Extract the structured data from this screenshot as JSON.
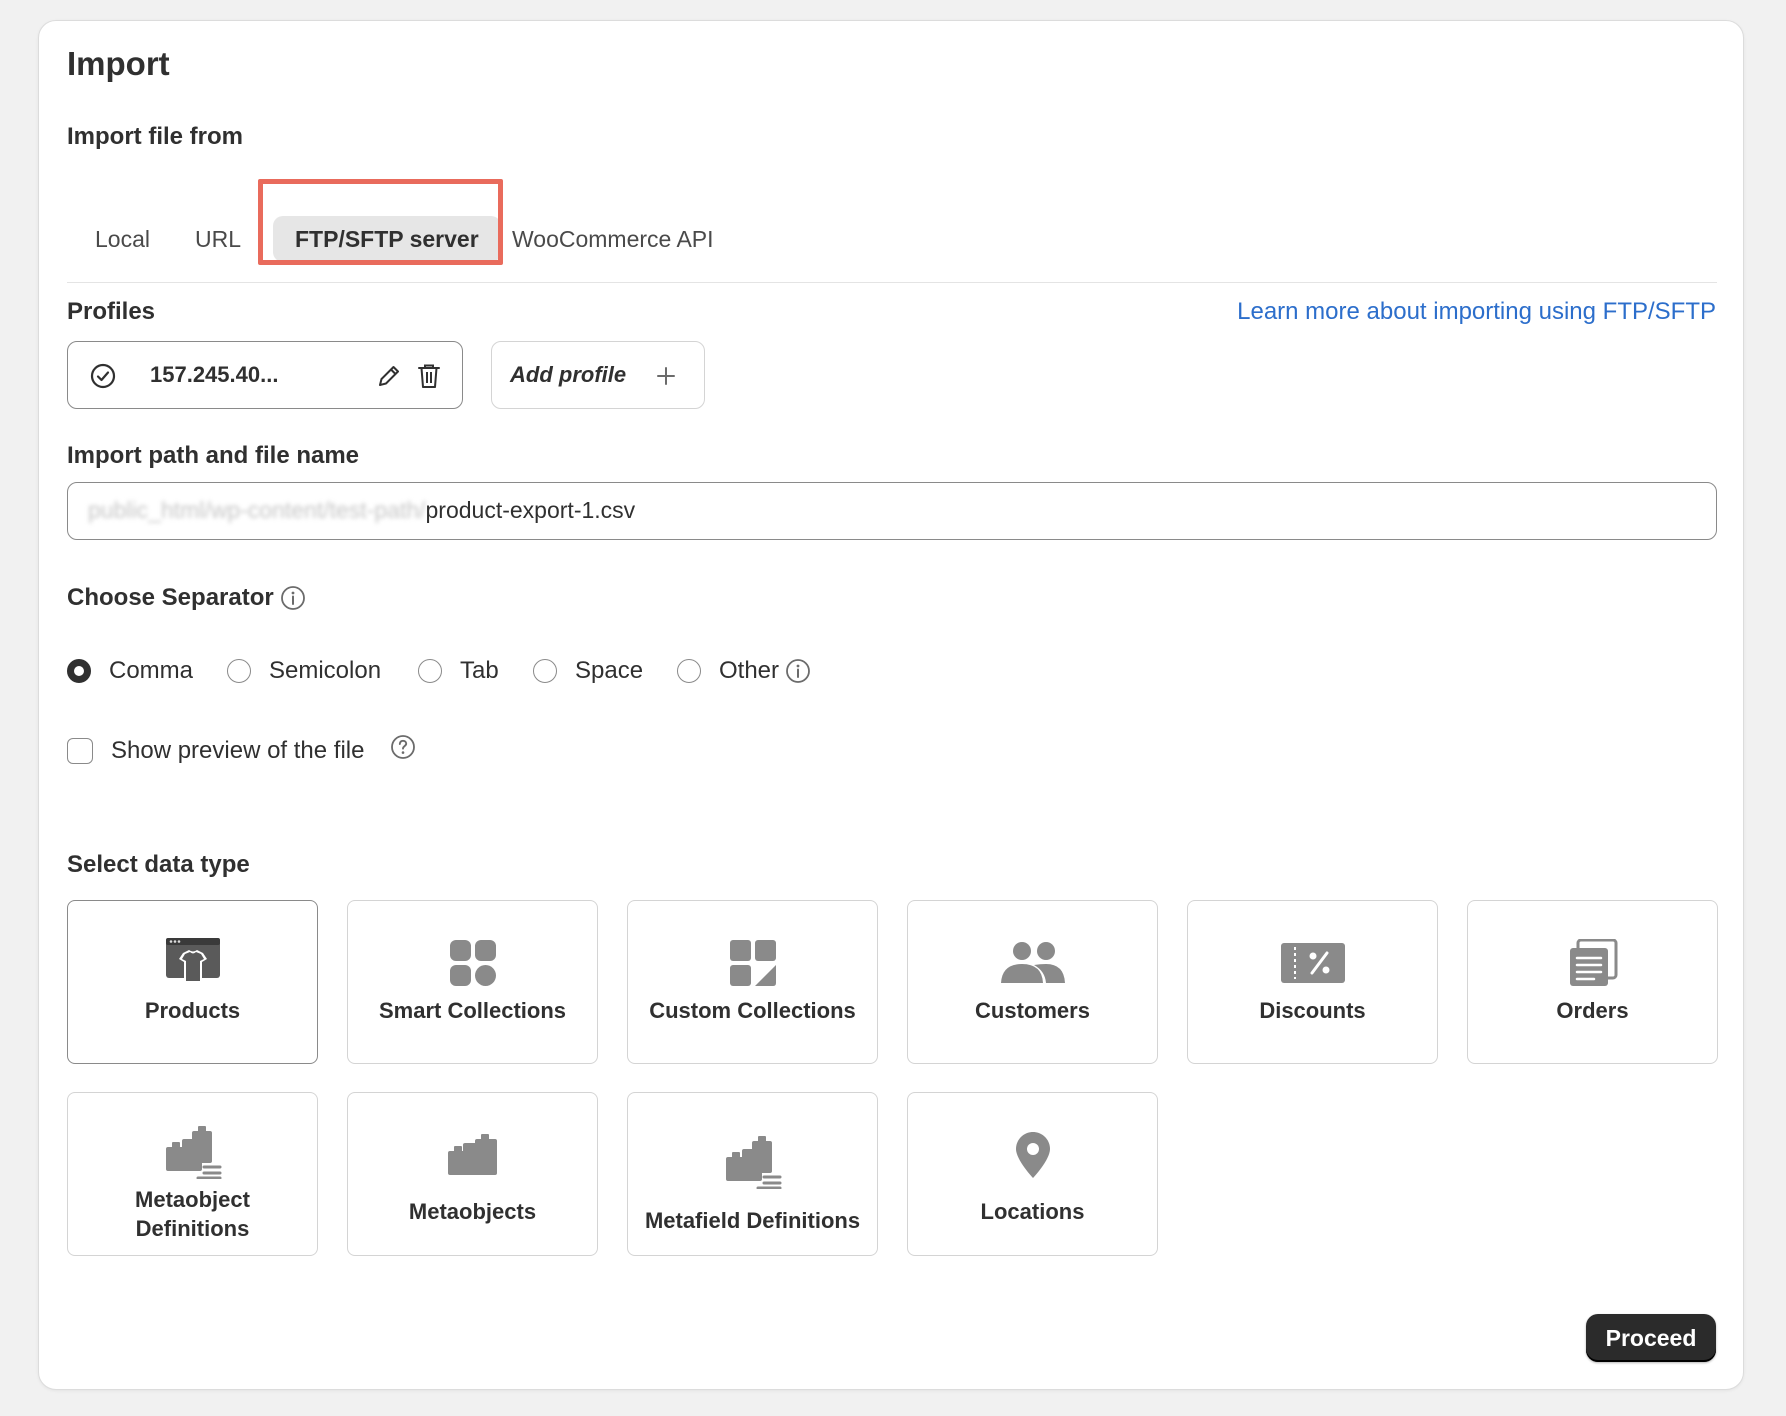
{
  "page": {
    "title": "Import"
  },
  "import_from": {
    "label": "Import file from",
    "tabs": [
      {
        "label": "Local",
        "active": false
      },
      {
        "label": "URL",
        "active": false
      },
      {
        "label": "FTP/SFTP server",
        "active": true
      },
      {
        "label": "WooCommerce API",
        "active": false
      }
    ]
  },
  "profiles": {
    "label": "Profiles",
    "learn_more": "Learn more about importing using FTP/SFTP",
    "current": {
      "host": "157.245.40..."
    },
    "add_label": "Add profile"
  },
  "path": {
    "label": "Import path and file name",
    "blurred_prefix": "public_html/wp-content/test-path/",
    "filename": "product-export-1.csv"
  },
  "separator": {
    "label": "Choose Separator",
    "options": [
      {
        "label": "Comma",
        "checked": true
      },
      {
        "label": "Semicolon",
        "checked": false
      },
      {
        "label": "Tab",
        "checked": false
      },
      {
        "label": "Space",
        "checked": false
      },
      {
        "label": "Other",
        "checked": false
      }
    ]
  },
  "preview": {
    "label": "Show preview of the file",
    "checked": false
  },
  "data_type": {
    "label": "Select data type",
    "items": [
      {
        "label": "Products",
        "icon": "products-icon",
        "selected": true
      },
      {
        "label": "Smart Collections",
        "icon": "smart-collections-icon",
        "selected": false
      },
      {
        "label": "Custom Collections",
        "icon": "custom-collections-icon",
        "selected": false
      },
      {
        "label": "Customers",
        "icon": "customers-icon",
        "selected": false
      },
      {
        "label": "Discounts",
        "icon": "discounts-icon",
        "selected": false
      },
      {
        "label": "Orders",
        "icon": "orders-icon",
        "selected": false
      },
      {
        "label": "Metaobject\nDefinitions",
        "icon": "metaobject-definitions-icon",
        "selected": false
      },
      {
        "label": "Metaobjects",
        "icon": "metaobjects-icon",
        "selected": false
      },
      {
        "label": "Metafield Definitions",
        "icon": "metafield-definitions-icon",
        "selected": false
      },
      {
        "label": "Locations",
        "icon": "locations-icon",
        "selected": false
      }
    ]
  },
  "actions": {
    "proceed": "Proceed"
  },
  "colors": {
    "accent": "#e96b5c",
    "link": "#2c6ecb",
    "primary_button": "#2b2b2b"
  }
}
